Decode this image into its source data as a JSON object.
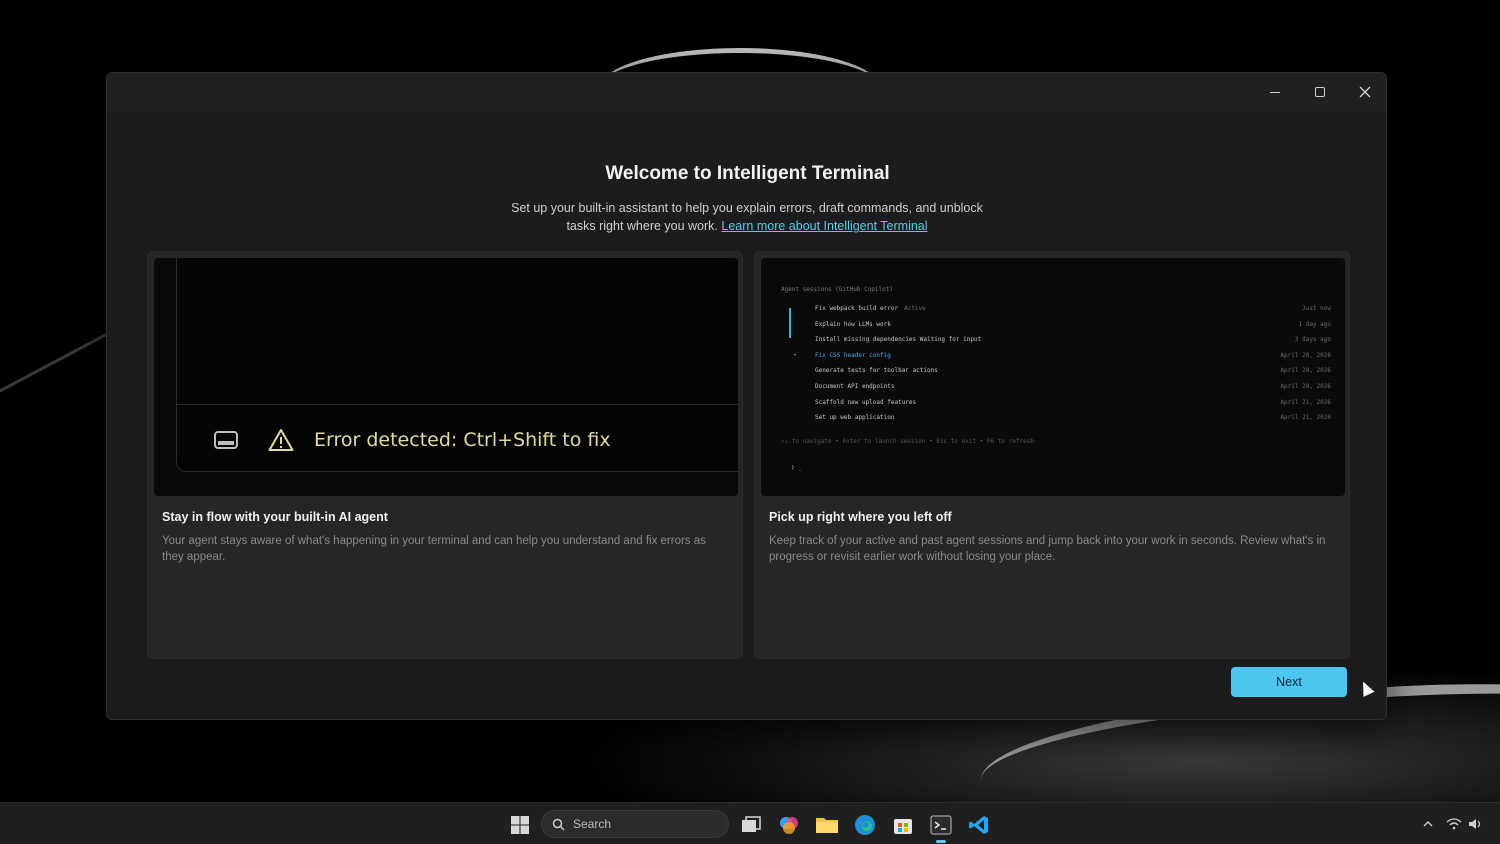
{
  "window": {
    "title": "Welcome to Intelligent Terminal",
    "subtitle": "Set up your built-in assistant to help you explain errors, draft commands, and unblock tasks right where you work.",
    "learn_more_link": "Learn more about Intelligent Terminal",
    "next_label": "Next"
  },
  "cards": [
    {
      "title": "Stay in flow with your built-in AI agent",
      "description": "Your agent stays aware of what's happening in your terminal and can help you understand and fix errors as they appear.",
      "error_text": "Error detected: Ctrl+Shift to fix"
    },
    {
      "title": "Pick up right where you left off",
      "description": "Keep track of your active and past agent sessions and jump back into your work in seconds. Review what's in progress or revisit earlier work without losing your place.",
      "sessions_header": "Agent sessions (GitHub Copilot)",
      "sessions": [
        {
          "name": "Fix webpack build error",
          "tag": "Active",
          "time": "Just now"
        },
        {
          "name": "Explain how LLMs work",
          "tag": "",
          "time": "1 day ago"
        },
        {
          "name": "Install missing dependencies  Waiting for input",
          "tag": "",
          "time": "3 days ago"
        },
        {
          "name": "Fix CSS header config",
          "tag": "",
          "time": "April 28, 2026"
        },
        {
          "name": "Generate tests for toolbar actions",
          "tag": "",
          "time": "April 28, 2026"
        },
        {
          "name": "Document API endpoints",
          "tag": "",
          "time": "April 28, 2026"
        },
        {
          "name": "Scaffold new upload features",
          "tag": "",
          "time": "April 21, 2026"
        },
        {
          "name": "Set up web application",
          "tag": "",
          "time": "April 21, 2026"
        }
      ],
      "sessions_footer": "↑↓ to navigate • Enter to launch session • Esc to exit • F6 to refresh",
      "prompt": "❯ _"
    }
  ],
  "taskbar": {
    "search_placeholder": "Search"
  },
  "colors": {
    "accent": "#4cc6ee",
    "window_bg": "#1c1c1e",
    "card_bg": "#262628",
    "warning": "#e2d9a4"
  }
}
